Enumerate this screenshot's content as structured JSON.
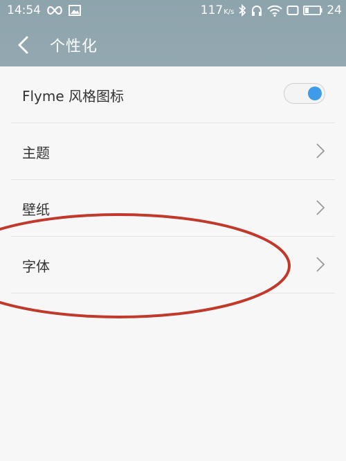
{
  "status_bar": {
    "time": "14:54",
    "net_speed": "117",
    "net_speed_unit": "K/s",
    "battery": "24",
    "icons": [
      "infinity-icon",
      "image-icon",
      "bluetooth-icon",
      "headphones-icon",
      "wifi-icon",
      "screen-icon",
      "battery-icon"
    ]
  },
  "header": {
    "title": "个性化",
    "back_icon": "back-arrow-icon"
  },
  "settings": [
    {
      "label": "Flyme 风格图标",
      "type": "toggle",
      "on": true
    },
    {
      "label": "主题",
      "type": "link"
    },
    {
      "label": "壁纸",
      "type": "link"
    },
    {
      "label": "字体",
      "type": "link"
    }
  ],
  "colors": {
    "header_bg": "#8ea4ad",
    "toggle_on": "#3d9be9",
    "annotation": "#c0392b"
  }
}
